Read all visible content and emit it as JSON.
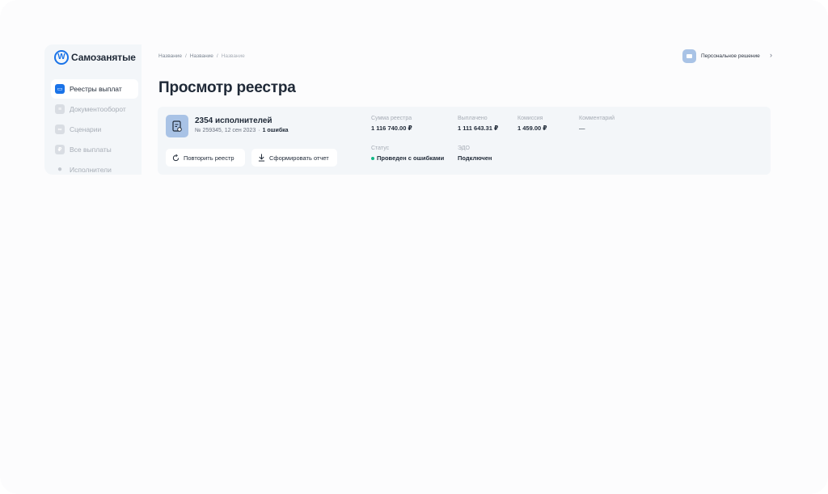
{
  "brand": {
    "name": "Самозанятые",
    "logo_icon": "samozanyatye-logo-icon",
    "accent": "#1a73e8"
  },
  "sidebar": {
    "items": [
      {
        "label": "Реестры выплат",
        "icon": "wallet-icon",
        "active": true
      },
      {
        "label": "Документооборот",
        "icon": "document-icon",
        "active": false
      },
      {
        "label": "Сценарии",
        "icon": "scenario-icon",
        "active": false
      },
      {
        "label": "Все выплаты",
        "icon": "payment-icon",
        "active": false
      },
      {
        "label": "Исполнители",
        "icon": "users-icon",
        "active": false
      }
    ]
  },
  "breadcrumb": [
    "Название",
    "Название",
    "Название"
  ],
  "user": {
    "name": "Персональное решение",
    "avatar_icon": "briefcase-icon"
  },
  "page": {
    "title": "Просмотр реестра"
  },
  "registry": {
    "title": "2354 исполнителей",
    "number_date": "№ 259345, 12 сен 2023",
    "separator": "·",
    "errors": "1 ошибка",
    "buttons": {
      "repeat": "Повторить реестр",
      "report": "Сформировать отчет"
    },
    "fields": {
      "sum": {
        "label": "Сумма реестра",
        "value": "1 116 740.00 ₽"
      },
      "paid": {
        "label": "Выплачено",
        "value": "1 111 643.31 ₽"
      },
      "commission": {
        "label": "Комиссия",
        "value": "1 459.00 ₽"
      },
      "comment": {
        "label": "Комментарий",
        "value": "—"
      },
      "status": {
        "label": "Статус",
        "value": "Проведен с ошибками",
        "color": "#12b886"
      },
      "edo": {
        "label": "ЭДО",
        "value": "Подключен"
      }
    }
  }
}
